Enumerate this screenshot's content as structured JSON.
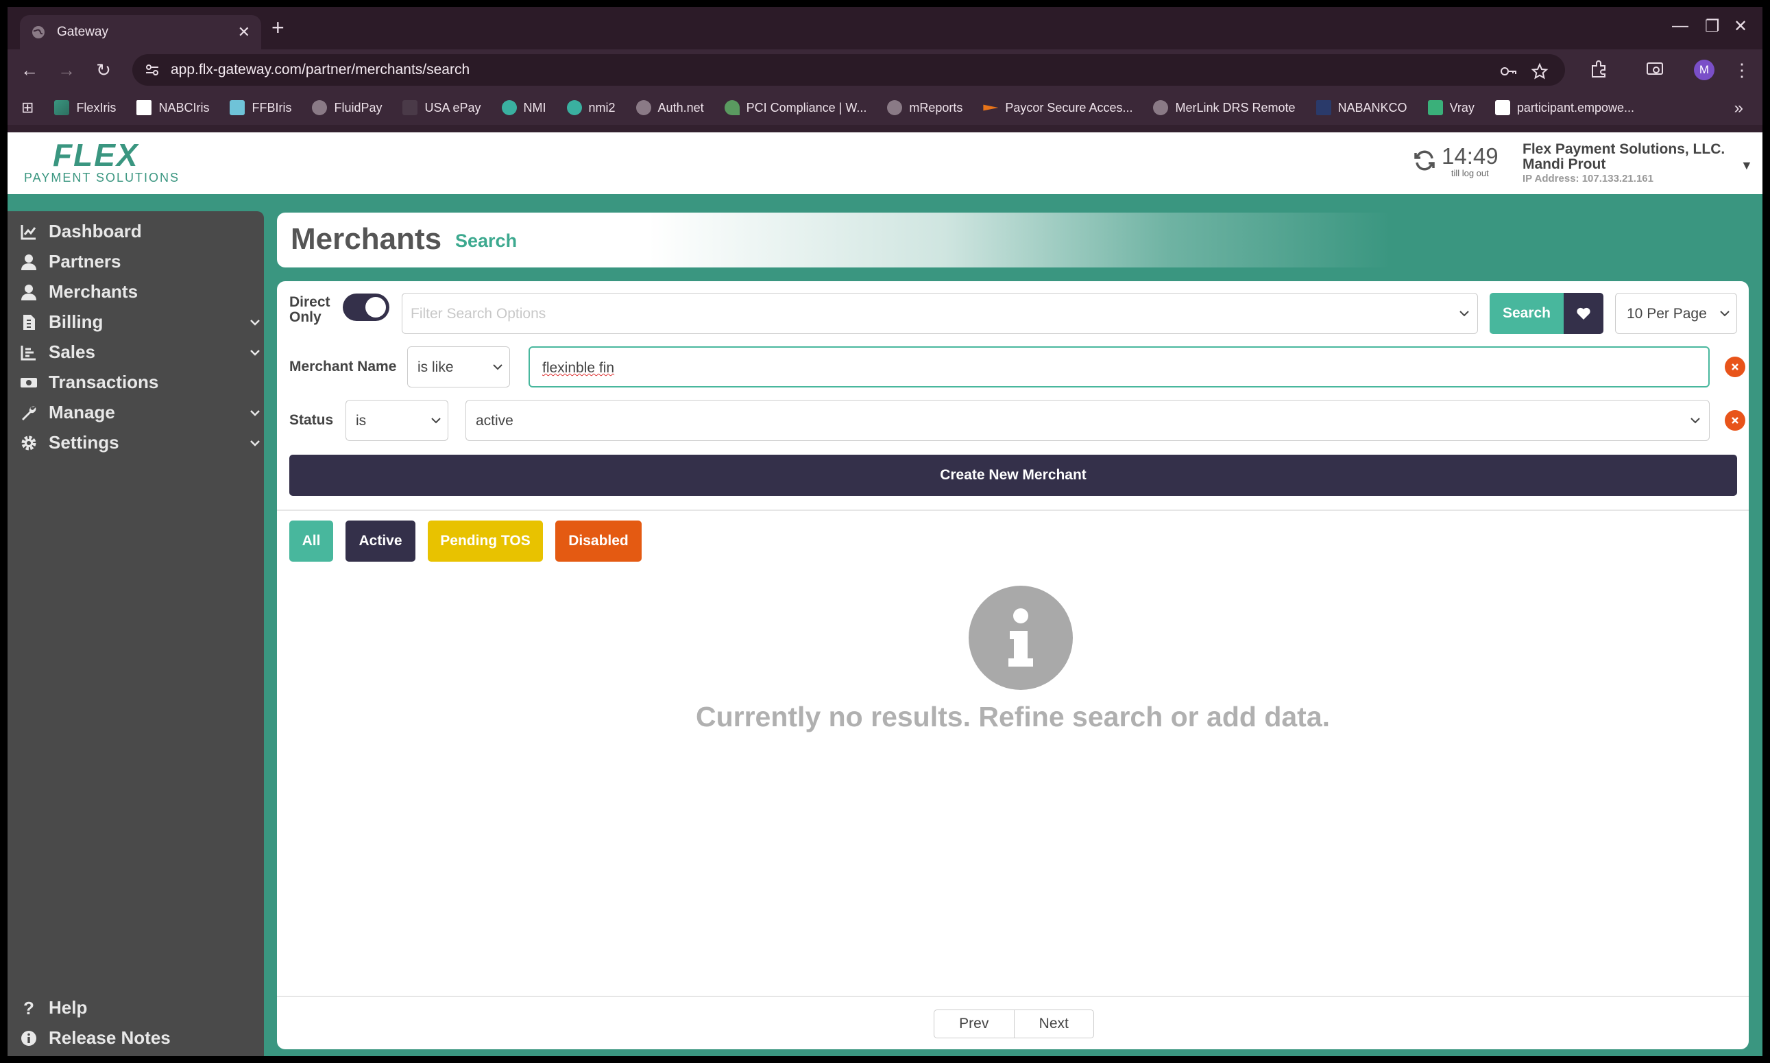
{
  "browser": {
    "tab_title": "Gateway",
    "url": "app.flx-gateway.com/partner/merchants/search",
    "profile_initial": "M",
    "bookmarks": [
      "FlexIris",
      "NABCIris",
      "FFBIris",
      "FluidPay",
      "USA ePay",
      "NMI",
      "nmi2",
      "Auth.net",
      "PCI Compliance | W...",
      "mReports",
      "Paycor Secure Acces...",
      "MerLink DRS Remote",
      "NABANKCO",
      "Vray",
      "participant.empowe..."
    ]
  },
  "header": {
    "logo_text": "FLEX",
    "logo_subtext": "PAYMENT SOLUTIONS",
    "timer": "14:49",
    "timer_label": "till log out",
    "company": "Flex Payment Solutions, LLC.",
    "user": "Mandi Prout",
    "ip": "IP Address: 107.133.21.161"
  },
  "sidebar": {
    "items": [
      {
        "label": "Dashboard",
        "icon": "chart-line-icon"
      },
      {
        "label": "Partners",
        "icon": "user-icon"
      },
      {
        "label": "Merchants",
        "icon": "user-icon"
      },
      {
        "label": "Billing",
        "icon": "file-invoice-icon"
      },
      {
        "label": "Sales",
        "icon": "bar-chart-icon"
      },
      {
        "label": "Transactions",
        "icon": "money-icon"
      },
      {
        "label": "Manage",
        "icon": "wrench-icon"
      },
      {
        "label": "Settings",
        "icon": "gear-icon"
      }
    ],
    "bottom": [
      {
        "label": "Help",
        "icon": "question-icon"
      },
      {
        "label": "Release Notes",
        "icon": "info-icon"
      }
    ]
  },
  "main": {
    "title": "Merchants",
    "subtitle": "Search",
    "direct_only_label": "Direct Only",
    "filter_placeholder": "Filter Search Options",
    "search_label": "Search",
    "per_page": "10 Per Page",
    "filters": [
      {
        "label": "Merchant Name",
        "operator": "is like",
        "value": "flexinble fin"
      },
      {
        "label": "Status",
        "operator": "is",
        "value": "active"
      }
    ],
    "create_label": "Create New Merchant",
    "status_tabs": [
      {
        "label": "All",
        "color": "#48b79d"
      },
      {
        "label": "Active",
        "color": "#34304a"
      },
      {
        "label": "Pending TOS",
        "color": "#e8c200"
      },
      {
        "label": "Disabled",
        "color": "#e45a12"
      }
    ],
    "empty_message": "Currently no results. Refine search or add data.",
    "pager": {
      "prev": "Prev",
      "next": "Next"
    }
  },
  "colors": {
    "brand": "#3a9680",
    "accent": "#48b79d",
    "dark": "#34304a",
    "danger": "#e8541a"
  }
}
